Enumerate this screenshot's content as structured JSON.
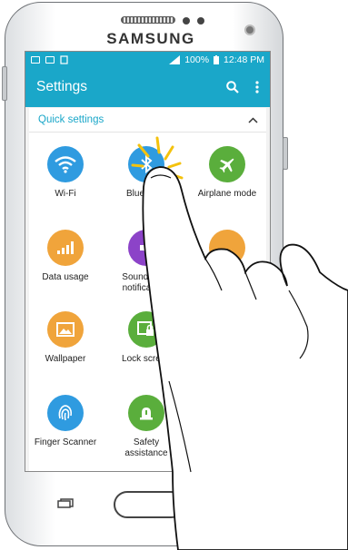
{
  "device": {
    "brand": "SAMSUNG"
  },
  "status_bar": {
    "battery": "100%",
    "time": "12:48 PM"
  },
  "app_bar": {
    "title": "Settings"
  },
  "quick_settings": {
    "title": "Quick settings",
    "tiles": [
      {
        "label": "Wi-Fi",
        "icon": "wifi-icon",
        "color": "#2f9be0"
      },
      {
        "label": "Blue",
        "icon": "bluetooth-icon",
        "color": "#2f9be0"
      },
      {
        "label": "Airplane mode",
        "icon": "airplane-icon",
        "color": "#5aae3c"
      },
      {
        "label": "Data usage",
        "icon": "data-usage-icon",
        "color": "#f0a43b"
      },
      {
        "label": "Sounds and",
        "label2": "notifications",
        "icon": "sound-icon",
        "color": "#8c43c8"
      },
      {
        "label": "",
        "icon": "display-icon",
        "color": "#f0a43b"
      },
      {
        "label": "Wallpaper",
        "icon": "wallpaper-icon",
        "color": "#f0a43b"
      },
      {
        "label": "Lock screen",
        "icon": "lock-screen-icon",
        "color": "#5aae3c"
      },
      {
        "label": "Finger Scanner",
        "icon": "fingerprint-icon",
        "color": "#2f9be0"
      },
      {
        "label": "Safety",
        "label2": "assistance",
        "icon": "safety-icon",
        "color": "#5aae3c"
      }
    ]
  },
  "colors": {
    "accent": "#1aa7c9",
    "tap_highlight": "#f4c20d"
  }
}
